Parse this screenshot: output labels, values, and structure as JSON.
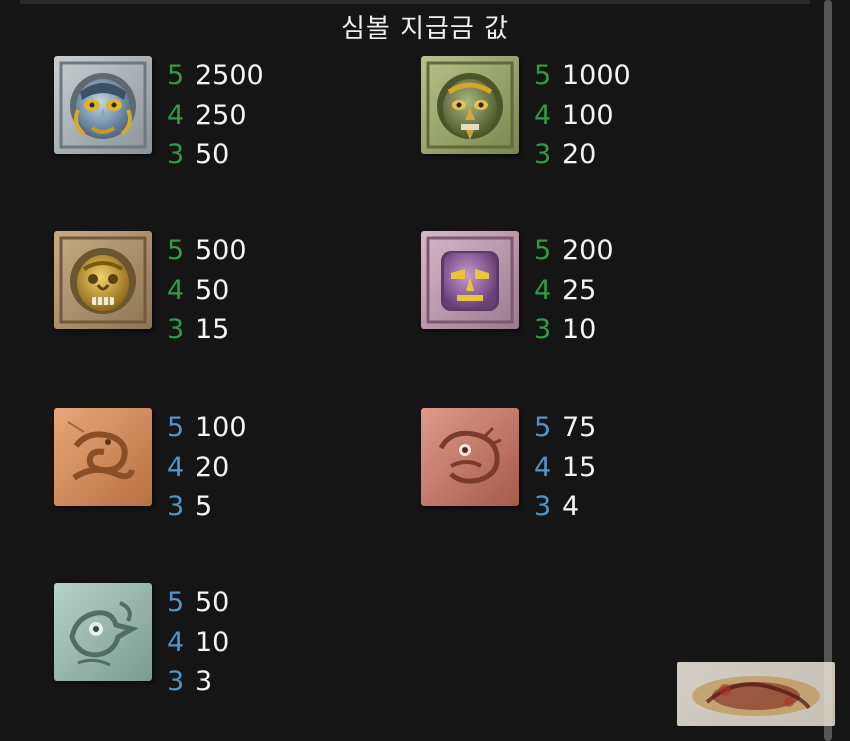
{
  "title": "심볼 지급금 값",
  "colors": {
    "background": "#151515",
    "text": "#f2f2f2",
    "count_green": "#2f9a48",
    "count_blue": "#4f95c8"
  },
  "symbols": [
    {
      "icon": "blue-silver-mask-icon",
      "count_color": "#2f9a48",
      "pays": [
        {
          "count": "5",
          "value": "2500"
        },
        {
          "count": "4",
          "value": "250"
        },
        {
          "count": "3",
          "value": "50"
        }
      ]
    },
    {
      "icon": "green-gold-mask-icon",
      "count_color": "#2f9a48",
      "pays": [
        {
          "count": "5",
          "value": "1000"
        },
        {
          "count": "4",
          "value": "100"
        },
        {
          "count": "3",
          "value": "20"
        }
      ]
    },
    {
      "icon": "gold-mask-icon",
      "count_color": "#2f9a48",
      "pays": [
        {
          "count": "5",
          "value": "500"
        },
        {
          "count": "4",
          "value": "50"
        },
        {
          "count": "3",
          "value": "15"
        }
      ]
    },
    {
      "icon": "purple-mask-icon",
      "count_color": "#2f9a48",
      "pays": [
        {
          "count": "5",
          "value": "200"
        },
        {
          "count": "4",
          "value": "25"
        },
        {
          "count": "3",
          "value": "10"
        }
      ]
    },
    {
      "icon": "orange-serpent-stone-icon",
      "count_color": "#4f95c8",
      "pays": [
        {
          "count": "5",
          "value": "100"
        },
        {
          "count": "4",
          "value": "20"
        },
        {
          "count": "3",
          "value": "5"
        }
      ]
    },
    {
      "icon": "red-jaguar-stone-icon",
      "count_color": "#4f95c8",
      "pays": [
        {
          "count": "5",
          "value": "75"
        },
        {
          "count": "4",
          "value": "15"
        },
        {
          "count": "3",
          "value": "4"
        }
      ]
    },
    {
      "icon": "teal-bird-stone-icon",
      "count_color": "#4f95c8",
      "pays": [
        {
          "count": "5",
          "value": "50"
        },
        {
          "count": "4",
          "value": "10"
        },
        {
          "count": "3",
          "value": "3"
        }
      ]
    }
  ]
}
